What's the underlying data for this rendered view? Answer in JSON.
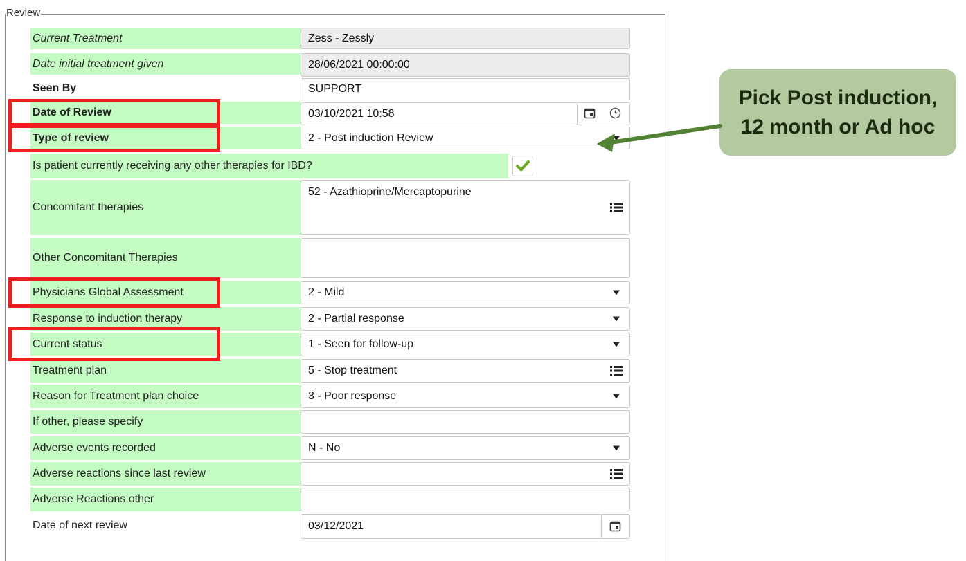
{
  "fieldset": {
    "legend": "Review"
  },
  "fields": {
    "current_treatment": {
      "label": "Current Treatment",
      "value": "Zess - Zessly"
    },
    "date_initial_treatment": {
      "label": "Date initial treatment given",
      "value": "28/06/2021 00:00:00"
    },
    "seen_by": {
      "label": "Seen By",
      "value": "SUPPORT"
    },
    "date_of_review": {
      "label": "Date of Review",
      "value": "03/10/2021 10:58"
    },
    "type_of_review": {
      "label": "Type of review",
      "value": "2 - Post induction Review"
    },
    "other_therapies": {
      "label": "Is patient currently receiving any other therapies for IBD?",
      "checked": true
    },
    "concomitant": {
      "label": "Concomitant therapies",
      "value": "52 - Azathioprine/Mercaptopurine"
    },
    "other_concomitant": {
      "label": "Other Concomitant Therapies",
      "value": ""
    },
    "pga": {
      "label": "Physicians Global Assessment",
      "value": "2 - Mild"
    },
    "response_induction": {
      "label": "Response to induction therapy",
      "value": "2 - Partial response"
    },
    "current_status": {
      "label": "Current status",
      "value": "1 - Seen for follow-up"
    },
    "treatment_plan": {
      "label": "Treatment plan",
      "value": "5 - Stop treatment"
    },
    "reason_plan": {
      "label": "Reason for Treatment plan choice",
      "value": "3 - Poor response"
    },
    "if_other": {
      "label": "If other, please specify",
      "value": ""
    },
    "adverse_events": {
      "label": "Adverse events recorded",
      "value": "N - No"
    },
    "adverse_reactions": {
      "label": "Adverse reactions since last review",
      "value": ""
    },
    "adverse_other": {
      "label": "Adverse Reactions other",
      "value": ""
    },
    "next_review": {
      "label": "Date of next review",
      "value": "03/12/2021"
    }
  },
  "callout": {
    "line1": "Pick Post induction,",
    "line2": "12 month or Ad hoc"
  },
  "colors": {
    "label_bg": "#c3fbc3",
    "highlight": "#ee1f1f",
    "callout_bg": "#b3c99f",
    "arrow": "#548235",
    "check": "#6aaa1e"
  }
}
